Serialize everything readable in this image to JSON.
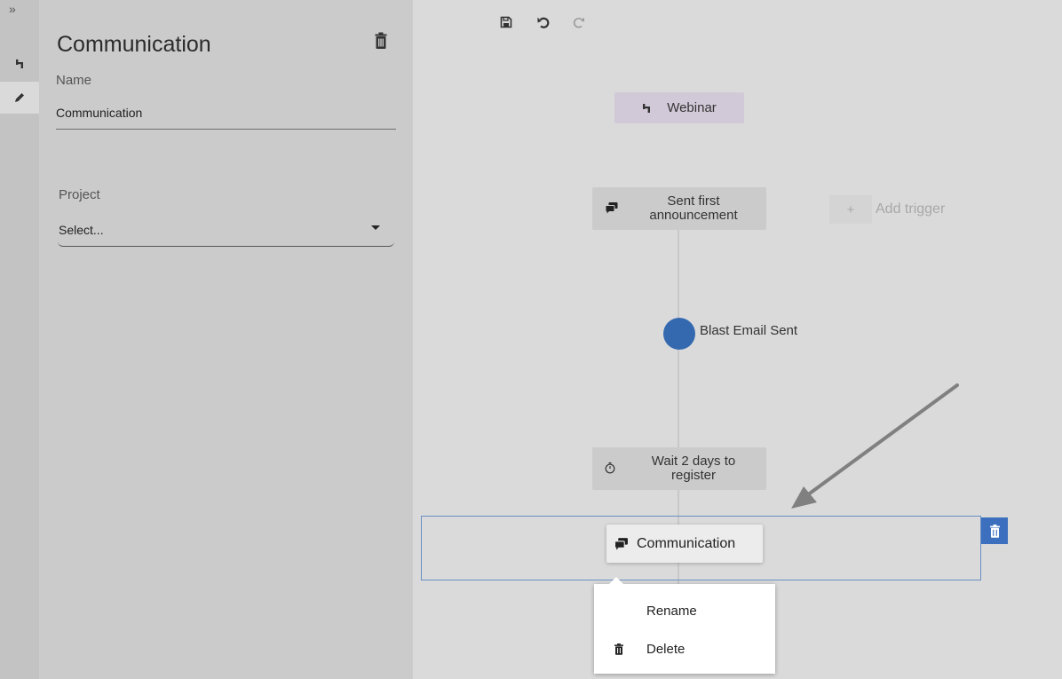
{
  "rail": {
    "expand_glyph": "»",
    "items": [
      {
        "icon": "flow-icon"
      },
      {
        "icon": "pencil-icon",
        "active": true
      }
    ]
  },
  "panel": {
    "title": "Communication",
    "name_label": "Name",
    "name_value": "Communication",
    "project_label": "Project",
    "project_value": "Select..."
  },
  "toolbar": {
    "save_icon": "save-icon",
    "undo_icon": "undo-icon",
    "redo_icon": "redo-icon"
  },
  "canvas": {
    "trigger_label": "Webinar",
    "step1_label": "Sent first announcement",
    "add_trigger_plus": "+",
    "add_trigger_label": "Add trigger",
    "event_label": "Blast Email Sent",
    "wait_label": "Wait 2 days to register",
    "selected_node_label": "Communication"
  },
  "context_menu": {
    "rename": "Rename",
    "delete": "Delete"
  },
  "colors": {
    "accent": "#3469b0",
    "selection_border": "#6a8fc4",
    "trigger_bg": "#d2c9d8"
  }
}
